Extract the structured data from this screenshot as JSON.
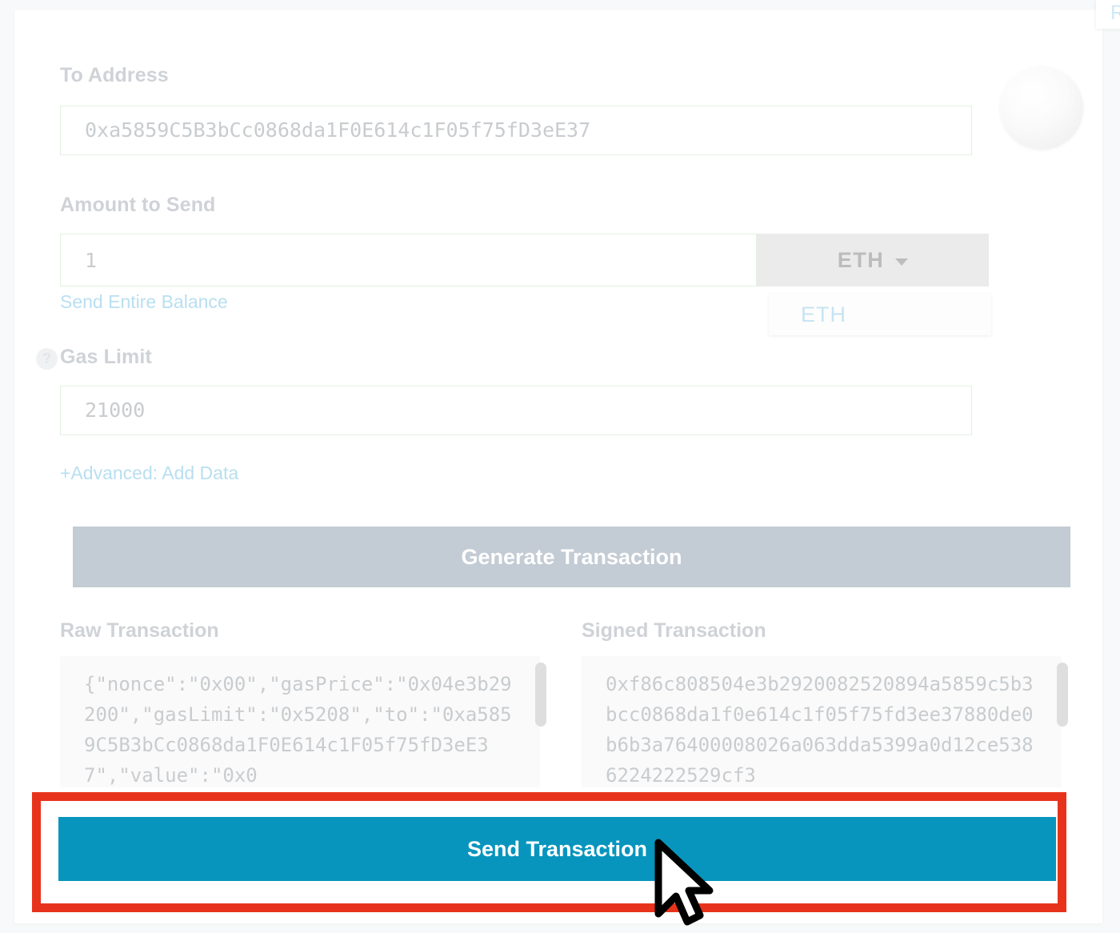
{
  "form": {
    "to_address": {
      "label": "To Address",
      "value": "0xa5859C5B3bCc0868da1F0E614c1F05f75fD3eE37"
    },
    "amount": {
      "label": "Amount to Send",
      "value": "1",
      "send_entire_balance_link": "Send Entire Balance"
    },
    "unit_dropdown": {
      "selected": "ETH",
      "caret_icon": "chevron-down-icon",
      "open": true,
      "options": [
        "ETH"
      ]
    },
    "gas_limit": {
      "label": "Gas Limit",
      "value": "21000",
      "help_icon": "question-mark-icon",
      "help_glyph": "?"
    },
    "advanced_link": "+Advanced: Add Data",
    "generate_button": "Generate Transaction",
    "send_button": "Send Transaction"
  },
  "transactions": {
    "raw": {
      "title": "Raw Transaction",
      "text": "{\"nonce\":\"0x00\",\"gasPrice\":\"0x04e3b29200\",\"gasLimit\":\"0x5208\",\"to\":\"0xa5859C5B3bCc0868da1F0E614c1F05f75fD3eE37\",\"value\":\"0x0"
    },
    "signed": {
      "title": "Signed Transaction",
      "text": "0xf86c808504e3b2920082520894a5859c5b3bcc0868da1f0e614c1f05f75fd3ee37880de0b6b3a76400008026a063dda5399a0d12ce5386224222529cf3"
    }
  },
  "side_popup": {
    "text": "R"
  },
  "icons": {
    "blockie": "address-blockie-avatar",
    "cursor": "mouse-pointer-cursor"
  },
  "colors": {
    "accent_blue": "#0795bd",
    "highlight_red": "#e8331c",
    "disabled_grey": "#c3cbd4",
    "link_blue": "#b8dff0",
    "label_grey": "#cfd2d6",
    "page_background": "#f8f9fa"
  }
}
